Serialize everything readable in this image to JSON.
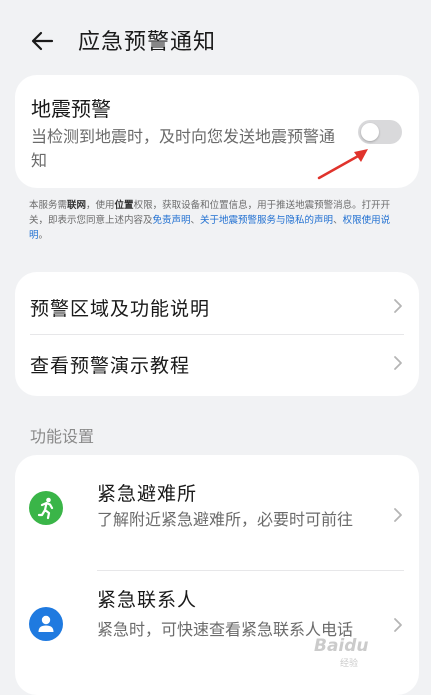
{
  "header": {
    "title": "应急预警通知"
  },
  "quake_card": {
    "title": "地震预警",
    "description": "当检测到地震时，及时向您发送地震预警通知",
    "toggle_on": false
  },
  "notice": {
    "p1": "本服务需",
    "network": "联网",
    "p2": "，使用",
    "location": "位置",
    "p3": "权限，获取设备和位置信息，用于推送地震预警消息。打开开关，即表示您同意上述内容及",
    "link_disclaimer": "免责声明",
    "sep1": "、",
    "link_privacy": "关于地震预警服务与隐私的声明",
    "sep2": "、",
    "link_permission": "权限使用说明",
    "end": "。"
  },
  "menu": {
    "items": [
      {
        "label": "预警区域及功能说明"
      },
      {
        "label": "查看预警演示教程"
      }
    ]
  },
  "settings": {
    "section_label": "功能设置",
    "items": [
      {
        "title": "紧急避难所",
        "description": "了解附近紧急避难所，必要时可前往",
        "icon": "running-person-icon",
        "icon_color": "#3ab548"
      },
      {
        "title": "紧急联系人",
        "description": "紧急时，可快速查看紧急联系人电话",
        "icon": "person-icon",
        "icon_color": "#1f7ae0"
      }
    ]
  },
  "watermark": {
    "text": "Baidu",
    "sub": "经验"
  }
}
